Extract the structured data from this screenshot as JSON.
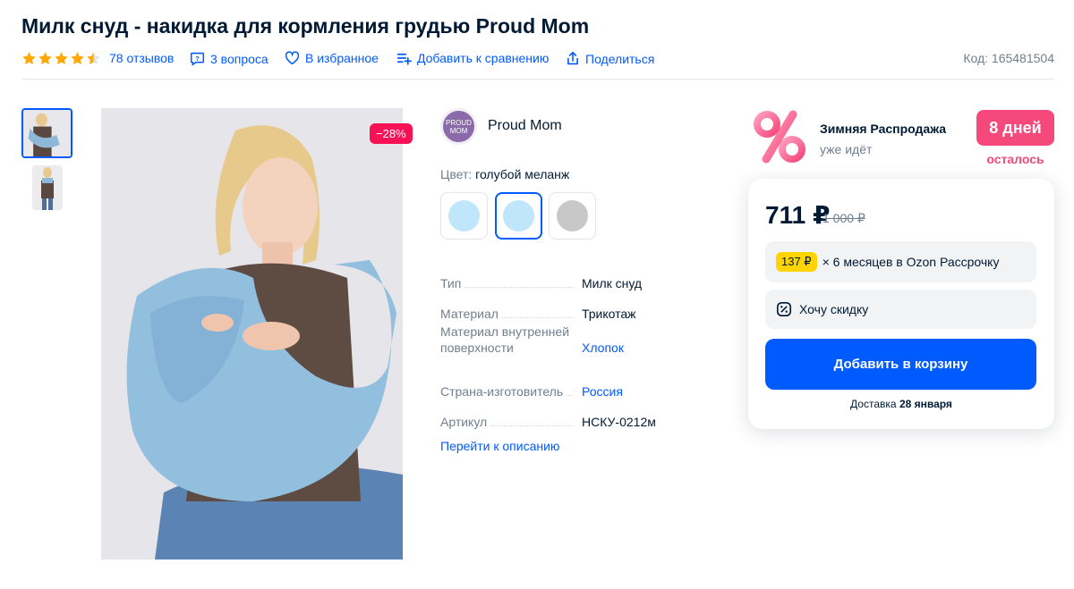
{
  "title": "Милк снуд - накидка для кормления грудью Proud Mom",
  "meta": {
    "rating": 4.5,
    "reviews": "78 отзывов",
    "questions": "3 вопроса",
    "favorite": "В избранное",
    "compare": "Добавить к сравнению",
    "share": "Поделиться",
    "code": "Код: 165481504"
  },
  "gallery": {
    "discount": "−28%"
  },
  "brand": {
    "logo_text": "PROUD MOM",
    "name": "Proud Mom"
  },
  "color": {
    "label": "Цвет:",
    "value": "голубой меланж",
    "swatches": [
      {
        "color": "#bfe6fb",
        "selected": false
      },
      {
        "color": "#bfe6fb",
        "selected": true
      },
      {
        "color": "#c8c8c8",
        "selected": false
      }
    ]
  },
  "specs": [
    {
      "key": "Тип",
      "value": "Милк снуд",
      "link": false
    },
    {
      "key": "Материал",
      "value": "Трикотаж",
      "link": false
    },
    {
      "key": "Материал внутренней поверхности",
      "value": "Хлопок",
      "link": true
    },
    {
      "key": "Страна-изготовитель",
      "value": "Россия",
      "link": true
    },
    {
      "key": "Артикул",
      "value": "НСКУ-0212м",
      "link": false
    }
  ],
  "to_description": "Перейти к описанию",
  "sale": {
    "title": "Зимняя Распродажа",
    "subtitle": "уже идёт",
    "days": "8 дней",
    "days_sub": "осталось"
  },
  "buy": {
    "price": "711 ₽",
    "old_price": "1 000 ₽",
    "installment_amount": "137 ₽",
    "installment_text": "× 6 месяцев в Ozon Рассрочку",
    "want_discount": "Хочу скидку",
    "add_to_cart": "Добавить в корзину",
    "delivery_label": "Доставка",
    "delivery_date": "28 января"
  },
  "colors": {
    "link": "#005bff",
    "accent": "#005bff",
    "sale_pink": "#f5497b",
    "discount_red": "#f91155",
    "installment_yellow": "#ffd400"
  }
}
